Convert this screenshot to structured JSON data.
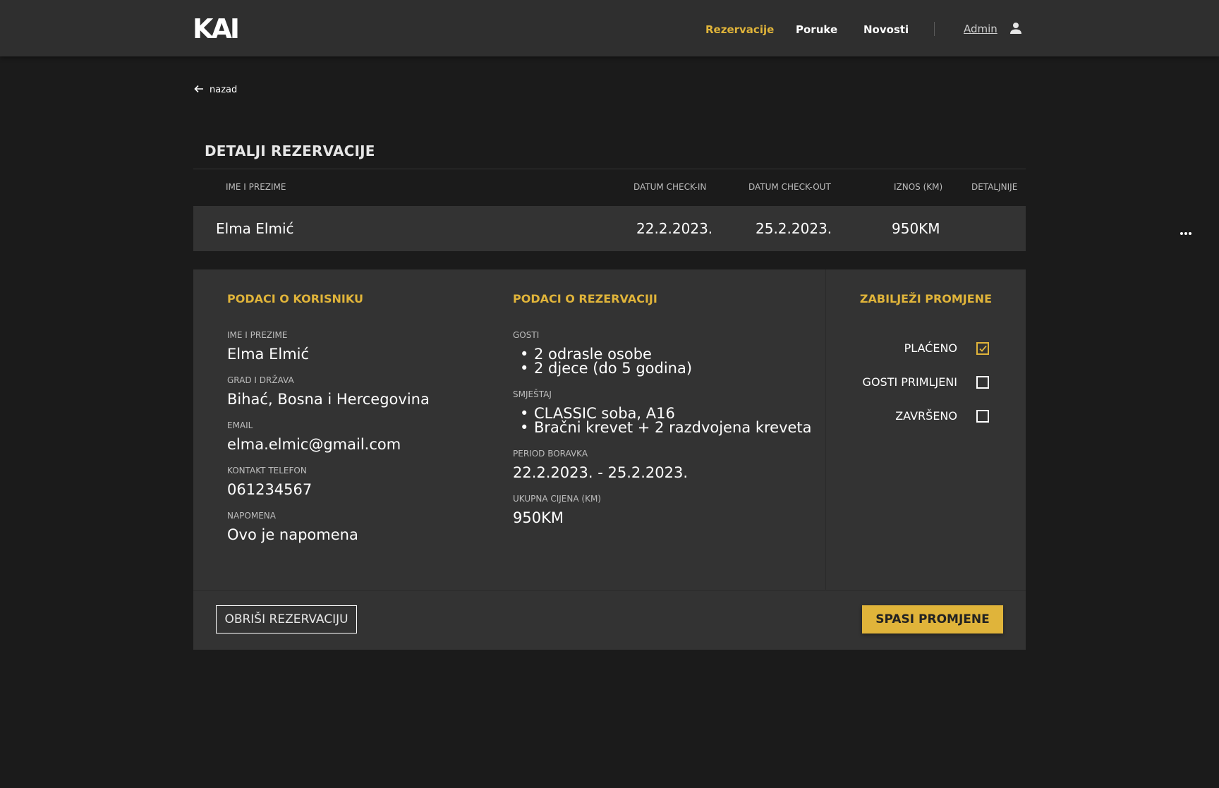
{
  "brand": {
    "logo_text": "KAI"
  },
  "nav": {
    "items": [
      {
        "label": "Rezervacije",
        "active": true
      },
      {
        "label": "Poruke",
        "active": false
      },
      {
        "label": "Novosti",
        "active": false
      }
    ],
    "admin_label": "Admin"
  },
  "back_label": "nazad",
  "section_title": "DETALJI REZERVACIJE",
  "table": {
    "headers": {
      "name": "IME I PREZIME",
      "checkin": "DATUM CHECK-IN",
      "checkout": "DATUM CHECK-OUT",
      "amount": "IZNOS (KM)",
      "details": "DETALJNIJE"
    },
    "row": {
      "name": "Elma Elmić",
      "checkin": "22.2.2023.",
      "checkout": "25.2.2023.",
      "amount": "950KM"
    }
  },
  "user_info": {
    "title": "PODACI O KORISNIKU",
    "name_label": "IME I PREZIME",
    "name": "Elma Elmić",
    "city_label": "GRAD I DRŽAVA",
    "city": "Bihać, Bosna i Hercegovina",
    "email_label": "EMAIL",
    "email": "elma.elmic@gmail.com",
    "phone_label": "KONTAKT TELEFON",
    "phone": "061234567",
    "note_label": "NAPOMENA",
    "note": "Ovo je napomena"
  },
  "reservation_info": {
    "title": "PODACI O REZERVACIJI",
    "guests_label": "GOSTI",
    "guests": [
      "2 odrasle osobe",
      "2 djece (do 5 godina)"
    ],
    "accommodation_label": "SMJEŠTAJ",
    "accommodation": [
      "CLASSIC soba, A16",
      "Bračni krevet + 2 razdvojena kreveta"
    ],
    "period_label": "PERIOD BORAVKA",
    "period": "22.2.2023. - 25.2.2023.",
    "total_label": "UKUPNA CIJENA (KM)",
    "total": "950KM"
  },
  "changes": {
    "title": "ZABILJEŽI PROMJENE",
    "paid_label": "PLAĆENO",
    "paid_checked": true,
    "guests_received_label": "GOSTI PRIMLJENI",
    "guests_received_checked": false,
    "completed_label": "ZAVRŠENO",
    "completed_checked": false
  },
  "actions": {
    "delete_label": "OBRIŠI REZERVACIJU",
    "save_label": "SPASI PROMJENE"
  },
  "colors": {
    "accent": "#e0b43a",
    "background": "#1b1b1b",
    "panel": "#333333",
    "topbar": "#2f2f2f"
  }
}
